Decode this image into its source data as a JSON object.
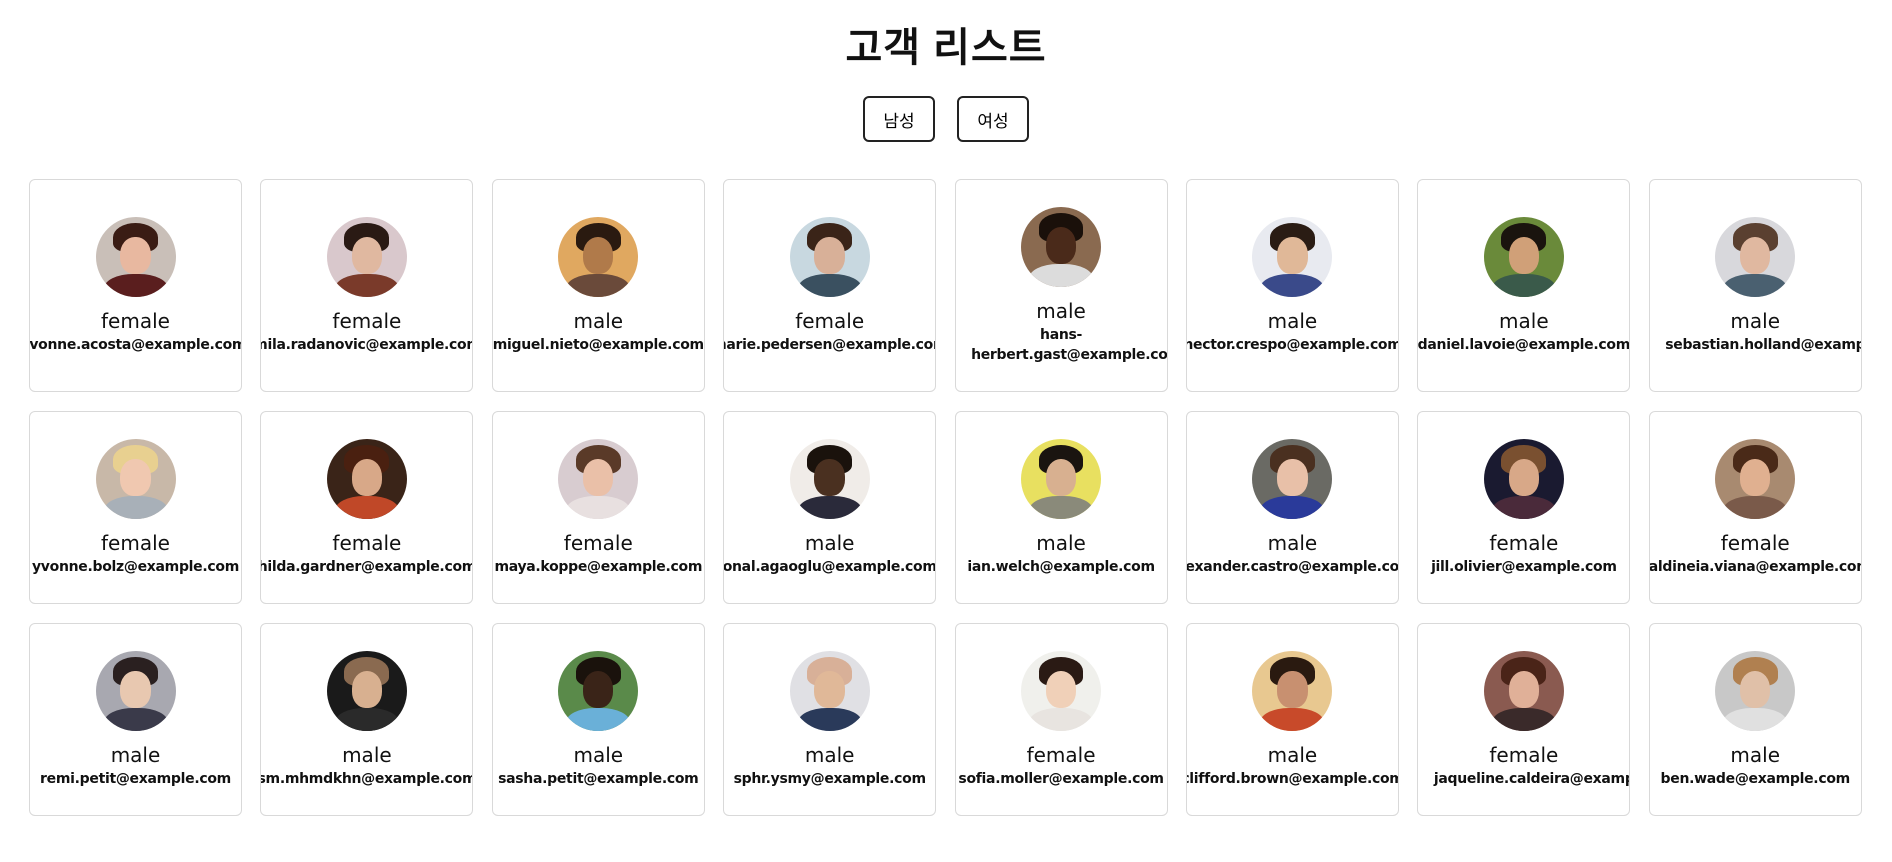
{
  "page": {
    "title": "고객 리스트"
  },
  "filters": {
    "male_label": "남성",
    "female_label": "여성"
  },
  "customers": [
    {
      "gender": "female",
      "email": "ivonne.acosta@example.com",
      "bg": "#c9bfb8",
      "skin": "#e8b8a0",
      "hair": "#3a1c14",
      "shirt": "#5a1e1e"
    },
    {
      "gender": "female",
      "email": "mila.radanovic@example.com",
      "bg": "#d9c8cc",
      "skin": "#e0b8a0",
      "hair": "#2a1a14",
      "shirt": "#7a3a2a"
    },
    {
      "gender": "male",
      "email": "miguel.nieto@example.com",
      "bg": "#e0a860",
      "skin": "#b07a4a",
      "hair": "#2a1a10",
      "shirt": "#6a4a3a"
    },
    {
      "gender": "female",
      "email": "marie.pedersen@example.com",
      "bg": "#c8d8e0",
      "skin": "#d8b098",
      "hair": "#3a2418",
      "shirt": "#3a5060"
    },
    {
      "gender": "male",
      "email": "hans-herbert.gast@example.com",
      "bg": "#8a6a50",
      "skin": "#4a2a1a",
      "hair": "#1a100a",
      "shirt": "#dcdcdc"
    },
    {
      "gender": "male",
      "email": "hector.crespo@example.com",
      "bg": "#e8eaf0",
      "skin": "#e0b898",
      "hair": "#2a1c14",
      "shirt": "#3a4a8a"
    },
    {
      "gender": "male",
      "email": "daniel.lavoie@example.com",
      "bg": "#6a8a3a",
      "skin": "#d0a078",
      "hair": "#1a140e",
      "shirt": "#3a5a4a"
    },
    {
      "gender": "male",
      "email": "sebastian.holland@example.com",
      "bg": "#d8d8dc",
      "skin": "#e0b8a0",
      "hair": "#5a4030",
      "shirt": "#4a6070"
    },
    {
      "gender": "female",
      "email": "yvonne.bolz@example.com",
      "bg": "#c8b8a8",
      "skin": "#f0c8b0",
      "hair": "#e8d090",
      "shirt": "#a8b0b8"
    },
    {
      "gender": "female",
      "email": "hilda.gardner@example.com",
      "bg": "#3a2418",
      "skin": "#d8a888",
      "hair": "#4a2010",
      "shirt": "#c04828"
    },
    {
      "gender": "female",
      "email": "maya.koppe@example.com",
      "bg": "#d8ccd0",
      "skin": "#eac0a8",
      "hair": "#5a3a28",
      "shirt": "#e8e0e0"
    },
    {
      "gender": "male",
      "email": "onal.agaoglu@example.com",
      "bg": "#f0ece8",
      "skin": "#4a3020",
      "hair": "#1a120c",
      "shirt": "#2a2a3a"
    },
    {
      "gender": "male",
      "email": "ian.welch@example.com",
      "bg": "#e8e060",
      "skin": "#d8b090",
      "hair": "#1a1410",
      "shirt": "#8a8a7a"
    },
    {
      "gender": "male",
      "email": "alexander.castro@example.com",
      "bg": "#6a6a64",
      "skin": "#e8c0a8",
      "hair": "#4a3020",
      "shirt": "#2a3a9a"
    },
    {
      "gender": "female",
      "email": "jill.olivier@example.com",
      "bg": "#1a1a30",
      "skin": "#d8a888",
      "hair": "#7a5030",
      "shirt": "#4a2a3a"
    },
    {
      "gender": "female",
      "email": "valdineia.viana@example.com",
      "bg": "#a88a70",
      "skin": "#e0b090",
      "hair": "#4a2a18",
      "shirt": "#7a5a4a"
    },
    {
      "gender": "male",
      "email": "remi.petit@example.com",
      "bg": "#a8a8b0",
      "skin": "#e8c8b0",
      "hair": "#2a2020",
      "shirt": "#3a3a4a"
    },
    {
      "gender": "male",
      "email": "sm.mhmdkhn@example.com",
      "bg": "#1a1a1a",
      "skin": "#d8b090",
      "hair": "#8a6a50",
      "shirt": "#2a2a2a"
    },
    {
      "gender": "male",
      "email": "sasha.petit@example.com",
      "bg": "#5a8a4a",
      "skin": "#3a2418",
      "hair": "#1a120c",
      "shirt": "#6ab0d8"
    },
    {
      "gender": "male",
      "email": "sphr.ysmy@example.com",
      "bg": "#e0e0e4",
      "skin": "#e0b898",
      "hair": "#d8b098",
      "shirt": "#2a3a5a"
    },
    {
      "gender": "female",
      "email": "sofia.moller@example.com",
      "bg": "#f0f0ec",
      "skin": "#f0d0b8",
      "hair": "#2a1a14",
      "shirt": "#e8e4e0"
    },
    {
      "gender": "male",
      "email": "clifford.brown@example.com",
      "bg": "#e8c890",
      "skin": "#c89070",
      "hair": "#2a1a10",
      "shirt": "#c84a2a"
    },
    {
      "gender": "female",
      "email": "jaqueline.caldeira@example.com",
      "bg": "#8a5a50",
      "skin": "#e0b098",
      "hair": "#4a2418",
      "shirt": "#3a2a2a"
    },
    {
      "gender": "male",
      "email": "ben.wade@example.com",
      "bg": "#c8c8c8",
      "skin": "#e0c0a8",
      "hair": "#b08050",
      "shirt": "#e0e0e0"
    }
  ]
}
